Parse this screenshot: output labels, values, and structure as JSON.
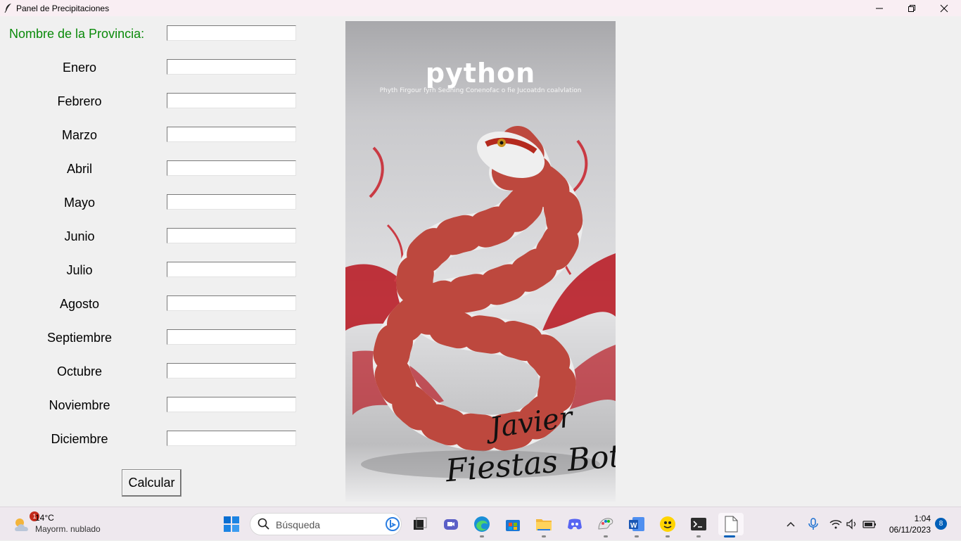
{
  "window": {
    "title": "Panel de Precipitaciones"
  },
  "form": {
    "province_label": "Nombre de la Provincia:",
    "province_value": "",
    "months": [
      {
        "label": "Enero",
        "value": ""
      },
      {
        "label": "Febrero",
        "value": ""
      },
      {
        "label": "Marzo",
        "value": ""
      },
      {
        "label": "Abril",
        "value": ""
      },
      {
        "label": "Mayo",
        "value": ""
      },
      {
        "label": "Junio",
        "value": ""
      },
      {
        "label": "Julio",
        "value": ""
      },
      {
        "label": "Agosto",
        "value": ""
      },
      {
        "label": "Septiembre",
        "value": ""
      },
      {
        "label": "Octubre",
        "value": ""
      },
      {
        "label": "Noviembre",
        "value": ""
      },
      {
        "label": "Diciembre",
        "value": ""
      }
    ],
    "calc_button": "Calcular",
    "province_color": "#0a8a0a"
  },
  "cover": {
    "title": "python",
    "subtitle": "Phyth Firgour fyrh Sedhing Conenofac o fie Jucoatdn coalvlation",
    "author_line1": "Javier",
    "author_line2": "Fiestas Botella"
  },
  "taskbar": {
    "weather_badge": "1",
    "weather_temp": "14°C",
    "weather_desc": "Mayorm. nublado",
    "search_placeholder": "Búsqueda",
    "time": "1:04",
    "date": "06/11/2023",
    "notifications": "8",
    "icons": [
      "windows-start-icon",
      "task-view-icon",
      "meet-icon",
      "edge-icon",
      "store-icon",
      "file-explorer-icon",
      "discord-icon",
      "paint-icon",
      "word-icon",
      "cyberghost-icon",
      "terminal-icon",
      "document-icon"
    ]
  }
}
